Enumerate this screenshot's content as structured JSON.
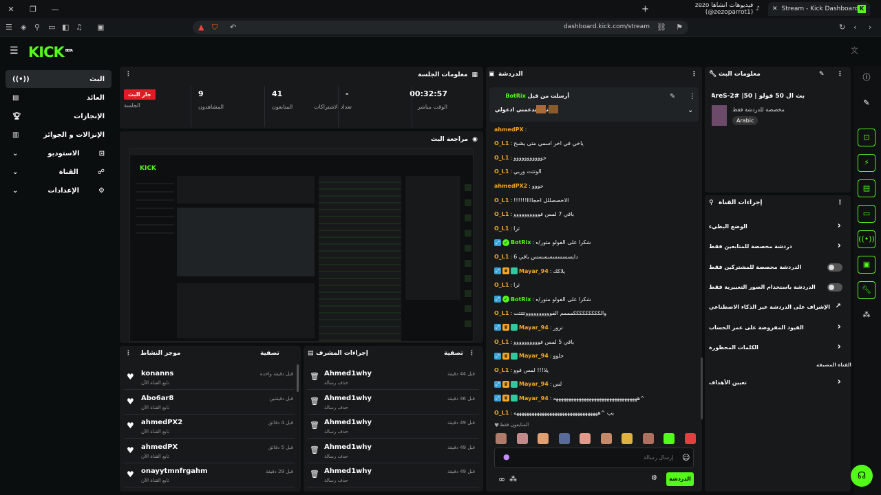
{
  "browser": {
    "tabs": [
      {
        "title": "Stream - Kick Dashboard",
        "active": true
      },
      {
        "title": "فيديوهات أنشأها zezo (@zezoparrot1)",
        "active": false
      }
    ],
    "url": "dashboard.kick.com/stream"
  },
  "brand": {
    "logo": "KICK",
    "beta": "BETA",
    "accent": "#53fc18"
  },
  "sidebar": {
    "items": [
      {
        "label": "البث",
        "icon": "broadcast-icon",
        "active": true
      },
      {
        "label": "العائد",
        "icon": "revenue-icon"
      },
      {
        "label": "الإنجازات",
        "icon": "trophy-icon"
      },
      {
        "label": "الإنزالات و الجوائز",
        "icon": "gift-icon"
      },
      {
        "label": "الاستوديو",
        "icon": "studio-icon"
      },
      {
        "label": "القناة",
        "icon": "channel-icon"
      },
      {
        "label": "الإعدادات",
        "icon": "gear-icon"
      }
    ]
  },
  "session": {
    "title": "معلومات الجلسة",
    "stats": [
      {
        "value": "00:32:57",
        "label": "الوقت مباشر"
      },
      {
        "value": "-",
        "label": "تعداد الاشتراكات"
      },
      {
        "value": "41",
        "label": "المتابعون"
      },
      {
        "value": "9",
        "label": "المشاهدون"
      },
      {
        "value": "جار البث",
        "label": "الجلسة"
      }
    ]
  },
  "preview": {
    "title": "مراجعة البث"
  },
  "activity": {
    "title": "موجز النشاط",
    "filter": "تصفية",
    "items": [
      {
        "name": "konanns",
        "sub": "تابع القناة الآن",
        "time": "قبل دقيقة واحدة"
      },
      {
        "name": "Abo6ar8",
        "sub": "تابع القناة الآن",
        "time": "قبل دقيقتين"
      },
      {
        "name": "ahmedPX2",
        "sub": "تابع القناة الآن",
        "time": "قبل 4 دقائق"
      },
      {
        "name": "ahmedPX",
        "sub": "تابع القناة الآن",
        "time": "قبل 5 دقائق"
      },
      {
        "name": "onayytmnfrgahm",
        "sub": "تابع القناة الآن",
        "time": "قبل 29 دقيقة"
      }
    ]
  },
  "modactions": {
    "title": "إجراءات المشرف",
    "filter": "تصفية",
    "items": [
      {
        "name": "Ahmed1why",
        "sub": "حذف رسالة",
        "time": "قبل 44 دقيقة"
      },
      {
        "name": "Ahmed1why",
        "sub": "حذف رسالة",
        "time": "قبل 46 دقيقة"
      },
      {
        "name": "Ahmed1why",
        "sub": "حذف رسالة",
        "time": "قبل 49 دقيقة"
      },
      {
        "name": "Ahmed1why",
        "sub": "حذف رسالة",
        "time": "قبل 49 دقيقة"
      },
      {
        "name": "Ahmed1why",
        "sub": "حذف رسالة",
        "time": "قبل 49 دقيقة"
      }
    ]
  },
  "chat": {
    "title": "الدردشة",
    "pinned_by": "BotRix",
    "pinned_label": "أرسلت من قبل",
    "pinned_text": "تبي تدعمني ادعولي",
    "messages": [
      {
        "user": "ahmedPX",
        "text": "",
        "color": "orange"
      },
      {
        "user": "O_L1",
        "text": "ياخي في اخر اسمي متى يشبح",
        "color": "orange"
      },
      {
        "user": "O_L1",
        "text": "حووووووووووو",
        "color": "orange"
      },
      {
        "user": "O_L1",
        "text": "الوتتت وربي",
        "color": "orange"
      },
      {
        "user": "ahmedPX2",
        "text": "حووو",
        "color": "orange"
      },
      {
        "user": "O_L1",
        "text": "الاخصصللل احجاااا!!!!!!",
        "color": "orange"
      },
      {
        "user": "O_L1",
        "text": "باقي 7 لمس فوووووووووو",
        "color": "orange"
      },
      {
        "user": "O_L1",
        "text": "ثرا",
        "color": "orange"
      },
      {
        "user": "BotRix",
        "text": "شكرا على الفولو متور/ه",
        "color": "green"
      },
      {
        "user": "O_L1",
        "text": "دايسسسسسسسس باقي 6",
        "color": "orange"
      },
      {
        "user": "Mayar_94",
        "text": "يلاكك",
        "color": "orange"
      },
      {
        "user": "O_L1",
        "text": "ثرا",
        "color": "orange"
      },
      {
        "user": "BotRix",
        "text": "شكرا على الفولو متور/ه",
        "color": "green"
      },
      {
        "user": "O_L1",
        "text": "والكككككككككمممم الفووووووووووتتتتت",
        "color": "orange"
      },
      {
        "user": "Mayar_94",
        "text": "ترور",
        "color": "orange"
      },
      {
        "user": "O_L1",
        "text": "باقي 5 لمس فوووووووووو",
        "color": "orange"
      },
      {
        "user": "Mayar_94",
        "text": "حلوو",
        "color": "orange"
      },
      {
        "user": "O_L1",
        "text": "يلا!!! لمس فوو",
        "color": "orange"
      },
      {
        "user": "Mayar_94",
        "text": "لس",
        "color": "orange"
      },
      {
        "user": "Mayar_94",
        "text": "^هههههههههههههههههههههههههههههههههه",
        "color": "orange"
      },
      {
        "user": "O_L1",
        "text": "يب ^هههههههههههههههههههههههههههههههههه",
        "color": "orange"
      }
    ],
    "followers_only": "المتابعون فقط",
    "input_placeholder": "إرسال رسالة",
    "send_label": "الدردشة"
  },
  "streaminfo": {
    "title": "معلومات البث",
    "stream_title": "بث ال 50 فولو | WeAreS-2# |50??",
    "category": "مخصصة للدردشة فقط",
    "language": "Arabic"
  },
  "channelactions": {
    "title": "إجراءات القناة",
    "rows": [
      {
        "label": "الوضع البطيء",
        "type": "chevron"
      },
      {
        "label": "دردشة مخصصة للمتابعين فقط",
        "type": "chevron"
      },
      {
        "label": "الدردشة مخصصة للمشتركين فقط",
        "type": "toggle"
      },
      {
        "label": "الدردشة باستخدام الصور التعبيرية فقط",
        "type": "toggle"
      },
      {
        "label": "الإشراف على الدردشة عبر الذكاء الاصطناعي",
        "type": "external"
      },
      {
        "label": "القيود المفروضة على عمر الحساب",
        "type": "chevron"
      },
      {
        "label": "الكلمات المحظورة",
        "type": "chevron"
      }
    ],
    "extra_heading": "القناة المضيفة",
    "extra_row": "تعيين الأهداف"
  }
}
